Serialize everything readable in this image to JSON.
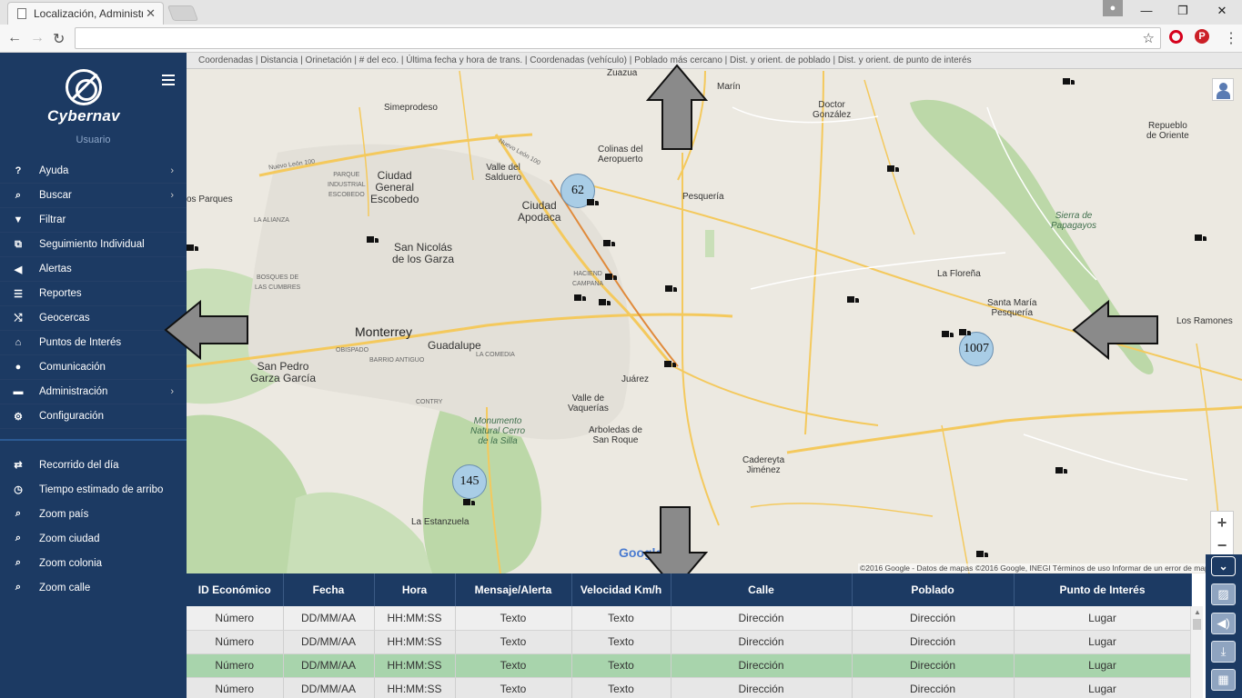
{
  "browser": {
    "tab_title": "Localización, Administrac",
    "tab_close": "✕",
    "win_minimize": "—",
    "win_restore": "❐",
    "win_close": "✕",
    "back": "←",
    "forward": "→",
    "reload": "↻",
    "star": "☆",
    "pinterest": "P",
    "menu": "⋮",
    "url": ""
  },
  "sidebar": {
    "logo_text": "Cybernav",
    "user_label": "Usuario",
    "items": [
      {
        "label": "Ayuda",
        "icon": "?",
        "chev": "›"
      },
      {
        "label": "Buscar",
        "icon": "⌕",
        "chev": "›"
      },
      {
        "label": "Filtrar",
        "icon": "▼",
        "chev": ""
      },
      {
        "label": "Seguimiento Individual",
        "icon": "⧉",
        "chev": ""
      },
      {
        "label": "Alertas",
        "icon": "◀",
        "chev": ""
      },
      {
        "label": "Reportes",
        "icon": "☰",
        "chev": ""
      },
      {
        "label": "Geocercas",
        "icon": "⤭",
        "chev": ""
      },
      {
        "label": "Puntos de Interés",
        "icon": "⌂",
        "chev": ""
      },
      {
        "label": "Comunicación",
        "icon": "●",
        "chev": ""
      },
      {
        "label": "Administración",
        "icon": "▬",
        "chev": "›"
      },
      {
        "label": "Configuración",
        "icon": "⚙",
        "chev": ""
      }
    ],
    "items2": [
      {
        "label": "Recorrido del día",
        "icon": "⇄"
      },
      {
        "label": "Tiempo estimado de arribo",
        "icon": "◷"
      },
      {
        "label": "Zoom país",
        "icon": "⌕"
      },
      {
        "label": "Zoom ciudad",
        "icon": "⌕"
      },
      {
        "label": "Zoom colonia",
        "icon": "⌕"
      },
      {
        "label": "Zoom calle",
        "icon": "⌕"
      }
    ]
  },
  "map": {
    "header": "Coordenadas | Distancia | Orinetación | # del eco. | Última fecha y hora de trans. | Coordenadas (vehículo) | Poblado más cercano | Dist. y orient. de poblado | Dist. y orient. de punto de interés",
    "labels": {
      "zuazua": "Zuazua",
      "marin": "Marín",
      "doctor_gonzalez": "Doctor\nGonzález",
      "simeprodeso": "Simeprodeso",
      "colinas": "Colinas del\nAeropuerto",
      "valle_salduero": "Valle del\nSalduero",
      "ciudad_escobedo": "Ciudad\nGeneral\nEscobedo",
      "ciudad_apodaca": "Ciudad\nApodaca",
      "pesqueria": "Pesquería",
      "san_nicolas": "San Nicolás\nde los Garza",
      "monterrey": "Monterrey",
      "guadalupe": "Guadalupe",
      "san_pedro": "San Pedro\nGarza García",
      "juarez": "Juárez",
      "valle_vaquerias": "Valle de\nVaquerías",
      "arboledas": "Arboledas de\nSan Roque",
      "cadereyta": "Cadereyta\nJiménez",
      "la_estanzuela": "La Estanzuela",
      "la_florena": "La Floreña",
      "santa_maria": "Santa María\nPesquería",
      "los_ramones": "Los Ramones",
      "repueblo": "Repueblo\nde Oriente",
      "sierra": "Sierra de\nPapagayos",
      "monumento": "Monumento\nNatural Cerro\nde la Silla",
      "parque_industrial": "PARQUE\nINDUSTRIAL\nESCOBEDO",
      "la_alianza": "LA ALIANZA",
      "bosques": "BOSQUES DE\nLAS CUMBRES",
      "obispado": "OBISPADO",
      "barrio_antiguo": "BARRIO ANTIGUO",
      "la_comedia": "LA COMEDIA",
      "contry": "CONTRY",
      "hacienda": "HACIEND\nCAMPANA",
      "os_parques": "os Parques",
      "nuevo_leon_100a": "Nuevo León 100",
      "nuevo_leon_100b": "Nuevo León 100"
    },
    "clusters": [
      "62",
      "1007",
      "145"
    ],
    "google": "Google",
    "attribution": "©2016 Google - Datos de mapas ©2016 Google, INEGI    Términos de uso    Informar de un error de mapa",
    "zoom_in": "+",
    "zoom_out": "−"
  },
  "table": {
    "headers": [
      "ID Económico",
      "Fecha",
      "Hora",
      "Mensaje/Alerta",
      "Velocidad Km/h",
      "Calle",
      "Poblado",
      "Punto de Interés"
    ],
    "rows": [
      [
        "Número",
        "DD/MM/AA",
        "HH:MM:SS",
        "Texto",
        "Texto",
        "Dirección",
        "Dirección",
        "Lugar"
      ],
      [
        "Número",
        "DD/MM/AA",
        "HH:MM:SS",
        "Texto",
        "Texto",
        "Dirección",
        "Dirección",
        "Lugar"
      ],
      [
        "Número",
        "DD/MM/AA",
        "HH:MM:SS",
        "Texto",
        "Texto",
        "Dirección",
        "Dirección",
        "Lugar"
      ],
      [
        "Número",
        "DD/MM/AA",
        "HH:MM:SS",
        "Texto",
        "Texto",
        "Dirección",
        "Dirección",
        "Lugar"
      ]
    ]
  },
  "right_buttons": {
    "collapse": "⌄",
    "image": "▨",
    "sound": "◀)",
    "download": "⤓",
    "grid": "▦"
  }
}
